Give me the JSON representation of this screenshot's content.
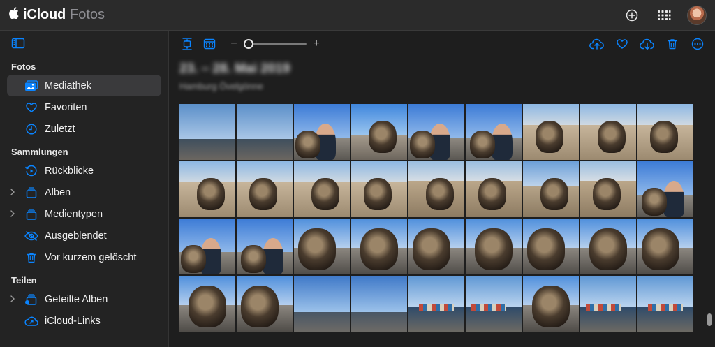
{
  "app": {
    "brand_primary": "iCloud",
    "brand_secondary": "Fotos"
  },
  "sidebar": {
    "sections": [
      {
        "title": "Fotos",
        "items": [
          {
            "label": "Mediathek",
            "icon": "library-icon",
            "active": true
          },
          {
            "label": "Favoriten",
            "icon": "heart-icon"
          },
          {
            "label": "Zuletzt",
            "icon": "clock-icon"
          }
        ]
      },
      {
        "title": "Sammlungen",
        "items": [
          {
            "label": "Rückblicke",
            "icon": "memories-icon"
          },
          {
            "label": "Alben",
            "icon": "albums-icon",
            "expandable": true
          },
          {
            "label": "Medientypen",
            "icon": "media-types-icon",
            "expandable": true
          },
          {
            "label": "Ausgeblendet",
            "icon": "hidden-eye-icon"
          },
          {
            "label": "Vor kurzem gelöscht",
            "icon": "trash-icon"
          }
        ]
      },
      {
        "title": "Teilen",
        "items": [
          {
            "label": "Geteilte Alben",
            "icon": "shared-albums-icon",
            "expandable": true
          },
          {
            "label": "iCloud-Links",
            "icon": "icloud-link-icon"
          }
        ]
      }
    ]
  },
  "toolbar": {
    "zoom_minus": "−",
    "zoom_plus": "+",
    "zoom_level": 0.0
  },
  "header": {
    "date_range": "23. – 28. Mai 2019",
    "location": "Hamburg Övelgönne"
  },
  "colors": {
    "accent": "#0a84ff",
    "background": "#1e1e1e",
    "sidebar": "#232323",
    "topbar": "#2b2b2b"
  },
  "grid": {
    "rows": 4,
    "columns": 9,
    "photos": [
      "harbor",
      "harbor",
      "selfie-dog",
      "dog-portrait",
      "selfie-dog",
      "selfie-dog",
      "dog-beach",
      "dog-beach",
      "dog-beach",
      "dog-beach",
      "dog-beach",
      "dog-beach",
      "dog-beach",
      "dog-sign",
      "dog-sign",
      "dog-rock",
      "dog-sign",
      "selfie-dog",
      "selfie-dog",
      "selfie-dog",
      "dog-closeup",
      "dog-closeup",
      "dog-closeup",
      "dog-closeup",
      "dog-closeup",
      "dog-closeup",
      "dog-closeup",
      "dog-closeup",
      "dog-closeup",
      "harbor-sky",
      "harbor-sky",
      "harbor-ship",
      "harbor-ship",
      "dog-closeup",
      "harbor-ship",
      "harbor-ship"
    ]
  }
}
